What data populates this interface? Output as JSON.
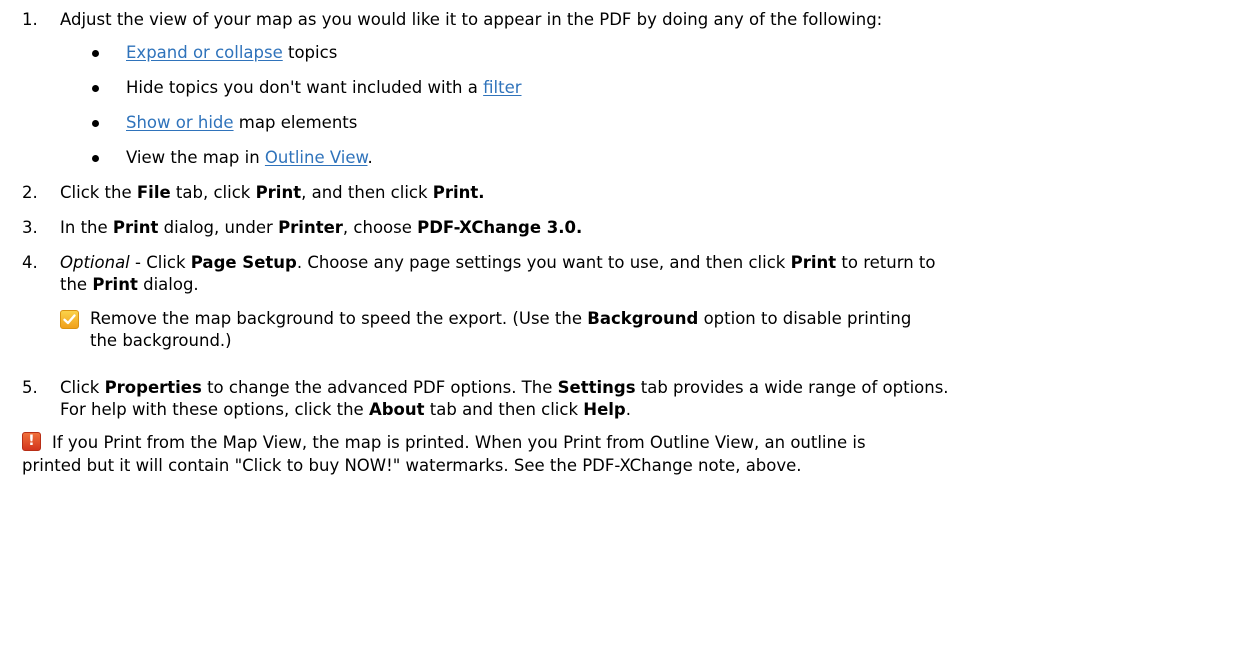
{
  "steps": [
    {
      "number": "1.",
      "text": "Adjust the view of your map as you would like it to appear in the PDF by doing any of the following:"
    },
    {
      "number": "2.",
      "parts": [
        "Click the ",
        "File",
        " tab, click ",
        "Print",
        ", and then click ",
        "Print."
      ]
    },
    {
      "number": "3.",
      "parts": [
        "In the ",
        "Print",
        " dialog, under ",
        "Printer",
        ", choose ",
        "PDF-XChange 3.0."
      ]
    },
    {
      "number": "4.",
      "parts": [
        "Optional",
        " - Click ",
        "Page Setup",
        ". Choose any page settings you want to use, and then click ",
        "Print",
        " to return to"
      ],
      "parts_line2": [
        "the ",
        "Print",
        " dialog."
      ]
    },
    {
      "number": "5.",
      "parts": [
        "Click ",
        "Properties",
        " to change the advanced PDF options. The ",
        "Settings",
        " tab provides a wide range of options."
      ],
      "parts_line2": [
        "For help with these options, click the ",
        "About",
        " tab and then click ",
        "Help",
        "."
      ]
    }
  ],
  "bullets": [
    {
      "link": "Expand or collapse",
      "after": " topics"
    },
    {
      "before": "Hide topics you don't want included with a ",
      "link": "filter"
    },
    {
      "link": "Show or hide",
      "after": " map elements"
    },
    {
      "before": "View the map in ",
      "link": "Outline View",
      "after": "."
    }
  ],
  "tip": {
    "icon": "checkmark-tip-icon",
    "line1": [
      "Remove the map background to speed the export. (Use the ",
      "Background",
      " option to disable printing"
    ],
    "line2": "the background.)"
  },
  "warning": {
    "icon": "exclamation-warning-icon",
    "symbol": "!",
    "line1": "If you Print from the Map View, the map is printed. When you Print from Outline View, an outline is",
    "line2": "printed but it will contain \"Click to buy NOW!\" watermarks. See the PDF-XChange note, above."
  },
  "colors": {
    "link": "#2f73bb",
    "tip_icon": "#f5b42a",
    "warning_icon": "#d9401f"
  }
}
